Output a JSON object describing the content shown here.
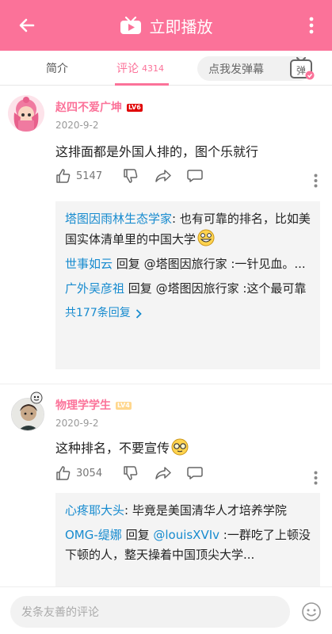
{
  "header": {
    "title": "立即播放",
    "back_icon": "back-arrow-icon",
    "more_icon": "more-vertical-icon",
    "accent": "#fb7299"
  },
  "tabs": {
    "intro": "简介",
    "comments": "评论",
    "comment_count": "4314"
  },
  "danmu": {
    "placeholder": "点我发弹幕",
    "button": "弹"
  },
  "comments": [
    {
      "user": "赵四不爱广坤",
      "level": "LV6",
      "date": "2020-9-2",
      "text": "这排面都是外国人排的，图个乐就行",
      "likes": "5147",
      "replies": [
        {
          "user": "塔图因雨林生态学家",
          "sep": ":",
          "text": " 也有可靠的排名，比如美国实体清单里的中国大学"
        },
        {
          "user": "世事如云",
          "reply_word": " 回复 ",
          "mention": "@塔图因旅行家",
          "text": " :一针见血。..."
        },
        {
          "user": "广外吴彦祖",
          "reply_word": " 回复 ",
          "mention": "@塔图因旅行家",
          "text": " :这个最可靠"
        }
      ],
      "more_replies": "共177条回复"
    },
    {
      "user": "物理学学生",
      "level": "LV4",
      "date": "2020-9-2",
      "text": "这种排名，不要宣传",
      "likes": "3054",
      "replies": [
        {
          "user": "心疼耶大头",
          "sep": ":",
          "text": " 毕竟是美国清华人才培养学院"
        },
        {
          "user": "OMG-缇娜",
          "reply_word": " 回复 ",
          "mention": "@louisXVIv",
          "text": " :一群吃了上顿没下顿的人，整天操着中国顶尖大学..."
        }
      ]
    }
  ],
  "composer": {
    "placeholder": "发条友善的评论",
    "emoji_icon": "emoji-smile-icon"
  }
}
